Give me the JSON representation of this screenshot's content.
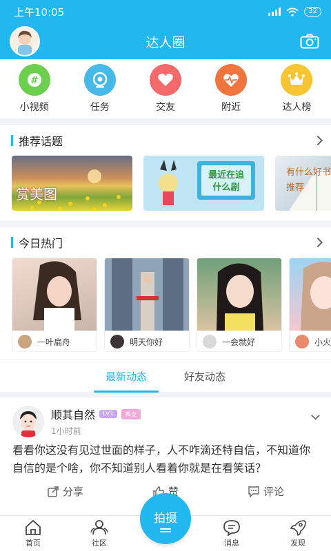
{
  "status_bar": {
    "time": "上午10:05",
    "battery": "32"
  },
  "header": {
    "title": "达人圈"
  },
  "categories": [
    {
      "label": "小视频",
      "icon": "hashtag-icon",
      "color": "#6ccf4e"
    },
    {
      "label": "任务",
      "icon": "target-icon",
      "color": "#47b8ea"
    },
    {
      "label": "交友",
      "icon": "heart-icon",
      "color": "#f46a6a"
    },
    {
      "label": "附近",
      "icon": "heartbeat-icon",
      "color": "#f0743e"
    },
    {
      "label": "达人榜",
      "icon": "crown-icon",
      "color": "#f7c531"
    }
  ],
  "topics_section": {
    "title": "推荐话题",
    "items": [
      {
        "text": "赏美图"
      },
      {
        "text": "最近在追什么剧"
      },
      {
        "text": "有什么好书推荐"
      }
    ]
  },
  "hot_section": {
    "title": "今日热门",
    "items": [
      {
        "user": "一叶扁舟"
      },
      {
        "user": "明天你好"
      },
      {
        "user": "一会就好"
      },
      {
        "user": "小火"
      }
    ]
  },
  "feed_tabs": [
    {
      "label": "最新动态",
      "active": true
    },
    {
      "label": "好友动态",
      "active": false
    }
  ],
  "post": {
    "name": "顺其自然",
    "level": "LV1",
    "tag": "秀女",
    "time": "1小时前",
    "text": "看看你这没有见过世面的样子，人不咋滴还特自信，不知道你自信的是个啥，你不知道别人看着你就是在看笑话？",
    "actions": {
      "share": "分享",
      "like": "赞",
      "comment": "评论"
    }
  },
  "bottom_nav": {
    "home": "首页",
    "community": "社区",
    "shoot": "拍摄",
    "messages": "消息",
    "discover": "发现"
  },
  "colors": {
    "primary": "#20b8ee",
    "level_badge": "#c9a6f5",
    "tag_badge": "#f3a7d8"
  }
}
